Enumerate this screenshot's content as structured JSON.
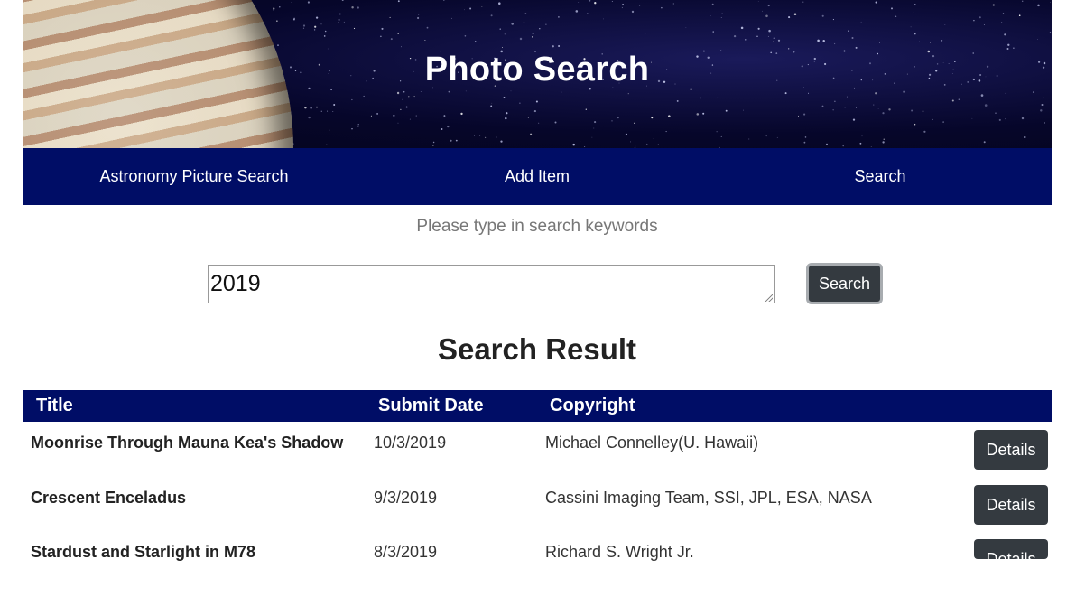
{
  "header": {
    "title": "Photo Search"
  },
  "nav": {
    "items": [
      "Astronomy Picture Search",
      "Add Item",
      "Search"
    ]
  },
  "search": {
    "prompt": "Please type in search keywords",
    "value": "2019",
    "button_label": "Search"
  },
  "results": {
    "title": "Search Result",
    "columns": [
      "Title",
      "Submit Date",
      "Copyright"
    ],
    "rows": [
      {
        "title": "Moonrise Through Mauna Kea's Shadow",
        "date": "10/3/2019",
        "copyright": "Michael Connelley(U. Hawaii)",
        "action": "Details"
      },
      {
        "title": "Crescent Enceladus",
        "date": "9/3/2019",
        "copyright": "Cassini Imaging Team, SSI, JPL, ESA, NASA",
        "action": "Details"
      },
      {
        "title": "Stardust and Starlight in M78",
        "date": "8/3/2019",
        "copyright": "Richard S. Wright Jr.",
        "action": "Details"
      }
    ]
  },
  "colors": {
    "nav_bg": "#000d66",
    "button_bg": "#343a40"
  }
}
